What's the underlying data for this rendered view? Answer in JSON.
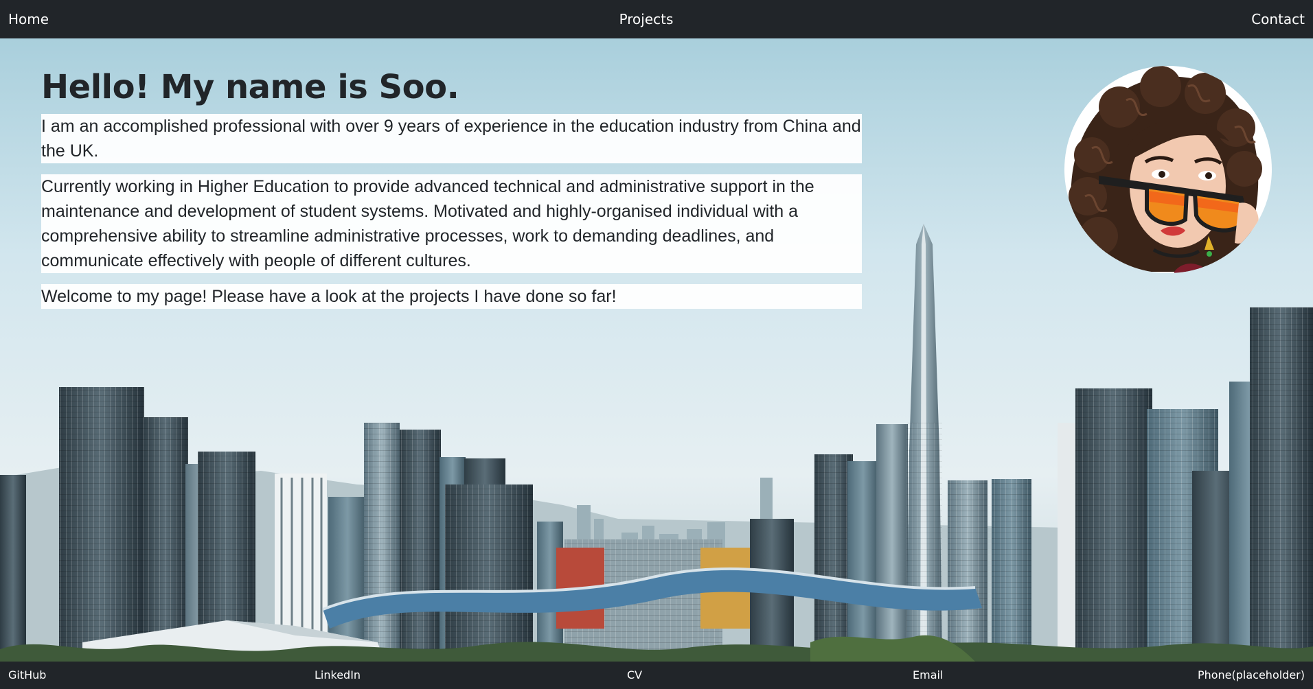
{
  "nav": {
    "home": "Home",
    "projects": "Projects",
    "contact": "Contact"
  },
  "hero": {
    "heading": "Hello! My name is Soo.",
    "paragraphs": [
      "I am an accomplished professional with over 9 years of experience in the education industry from China and the UK.",
      "Currently working in Higher Education to provide advanced technical and administrative support in the maintenance and development of student systems. Motivated and highly-organised individual with a comprehensive ability to streamline administrative processes, work to demanding deadlines, and communicate effectively with people of different cultures.",
      "Welcome to my page! Please have a look at the projects I have done so far!"
    ]
  },
  "avatar": {
    "icon": "cartoon-avatar-icon"
  },
  "background": {
    "icon": "city-skyline-image"
  },
  "footer": {
    "github": "GitHub",
    "linkedin": "LinkedIn",
    "cv": "CV",
    "email": "Email",
    "phone": "Phone(placeholder)"
  },
  "colors": {
    "navbar": "#212529",
    "text": "#212529",
    "sky": "#cfe3ec",
    "paragraph_background": "#ffffff"
  }
}
